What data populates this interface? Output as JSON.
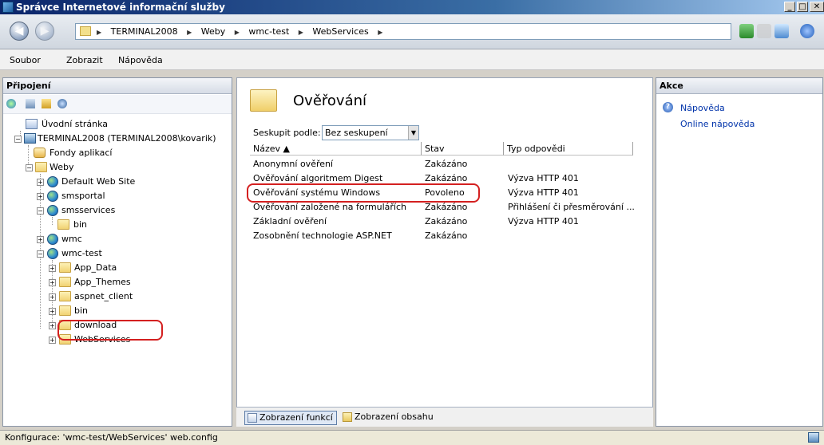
{
  "window": {
    "title": "Správce Internetové informační služby",
    "minimize": "_",
    "maximize": "□",
    "close": "✕"
  },
  "address": {
    "crumbs": [
      "TERMINAL2008",
      "Weby",
      "wmc-test",
      "WebServices"
    ]
  },
  "menu": {
    "items": [
      "Soubor",
      "Zobrazit",
      "Nápověda"
    ]
  },
  "connections": {
    "title": "Připojení",
    "tree": [
      {
        "label": "Úvodní stránka"
      },
      {
        "label": "TERMINAL2008 (TERMINAL2008\\kovarik)"
      },
      {
        "label": "Fondy aplikací"
      },
      {
        "label": "Weby"
      },
      {
        "label": "Default Web Site"
      },
      {
        "label": "smsportal"
      },
      {
        "label": "smsservices"
      },
      {
        "label": "bin"
      },
      {
        "label": "wmc"
      },
      {
        "label": "wmc-test"
      },
      {
        "label": "App_Data"
      },
      {
        "label": "App_Themes"
      },
      {
        "label": "aspnet_client"
      },
      {
        "label": "bin"
      },
      {
        "label": "download"
      },
      {
        "label": "WebServices"
      }
    ]
  },
  "feature": {
    "title": "Ověřování",
    "groupby_label": "Seskupit podle:",
    "groupby_value": "Bez seskupení",
    "columns": [
      "Název ▲",
      "Stav",
      "Typ odpovědi"
    ],
    "rows": [
      {
        "name": "Anonymní ověření",
        "state": "Zakázáno",
        "response": ""
      },
      {
        "name": "Ověřování algoritmem Digest",
        "state": "Zakázáno",
        "response": "Výzva HTTP 401"
      },
      {
        "name": "Ověřování systému Windows",
        "state": "Povoleno",
        "response": "Výzva HTTP 401"
      },
      {
        "name": "Ověřování založené na formulářích",
        "state": "Zakázáno",
        "response": "Přihlášení či přesměrování ..."
      },
      {
        "name": "Základní ověření",
        "state": "Zakázáno",
        "response": "Výzva HTTP 401"
      },
      {
        "name": "Zosobnění technologie ASP.NET",
        "state": "Zakázáno",
        "response": ""
      }
    ],
    "view_features": "Zobrazení funkcí",
    "view_content": "Zobrazení obsahu"
  },
  "actions": {
    "title": "Akce",
    "help": "Nápověda",
    "online_help": "Online nápověda"
  },
  "status": {
    "text": "Konfigurace: 'wmc-test/WebServices' web.config"
  },
  "colors": {
    "highlight": "#d42020",
    "link": "#0033aa"
  }
}
